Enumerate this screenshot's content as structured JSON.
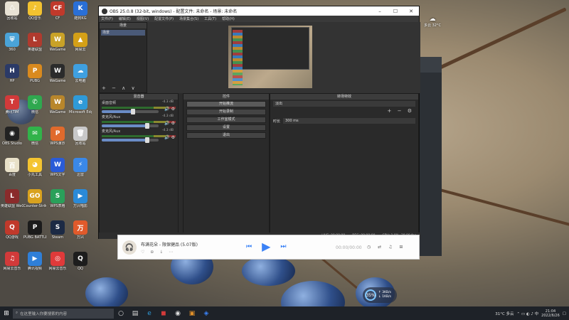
{
  "desktop": {
    "icons": [
      {
        "label": "回收站",
        "color": "#e8e2d4",
        "glyph": "♺"
      },
      {
        "label": "QQ音乐",
        "color": "#f2c230",
        "glyph": "♪"
      },
      {
        "label": "CF",
        "color": "#c0392b",
        "glyph": "CF"
      },
      {
        "label": "酷狗KG",
        "color": "#2a6fd6",
        "glyph": "K"
      },
      {
        "label": "360",
        "color": "#4aa3d8",
        "glyph": "⛨"
      },
      {
        "label": "英雄联盟",
        "color": "#b03a2e",
        "glyph": "L"
      },
      {
        "label": "WeGame",
        "color": "#c9a227",
        "glyph": "W"
      },
      {
        "label": "网易云",
        "color": "#d4a017",
        "glyph": "▲"
      },
      {
        "label": "HP",
        "color": "#2b3a67",
        "glyph": "H"
      },
      {
        "label": "PUBG",
        "color": "#d98a1e",
        "glyph": "P"
      },
      {
        "label": "WeGame",
        "color": "#2b2b2b",
        "glyph": "W"
      },
      {
        "label": "云电脑",
        "color": "#3fa0e0",
        "glyph": "☁"
      },
      {
        "label": "腾讯TIM",
        "color": "#d23a3a",
        "glyph": "T"
      },
      {
        "label": "微信",
        "color": "#2fa84f",
        "glyph": "✆"
      },
      {
        "label": "WeGame",
        "color": "#b8862b",
        "glyph": "W"
      },
      {
        "label": "Microsoft Edge",
        "color": "#2f9ad8",
        "glyph": "e"
      },
      {
        "label": "OBS Studio",
        "color": "#222222",
        "glyph": "◉"
      },
      {
        "label": "微信",
        "color": "#31b34a",
        "glyph": "✉"
      },
      {
        "label": "WPS演示",
        "color": "#e06a2c",
        "glyph": "P"
      },
      {
        "label": "回收站",
        "color": "#c8c8c8",
        "glyph": "🗑"
      },
      {
        "label": "百度",
        "color": "#e8e0c8",
        "glyph": "百"
      },
      {
        "label": "小丸工具",
        "color": "#f4c430",
        "glyph": "◕"
      },
      {
        "label": "WPS文字",
        "color": "#2a5bd7",
        "glyph": "W"
      },
      {
        "label": "迅雷",
        "color": "#3a88e8",
        "glyph": "⚡"
      },
      {
        "label": "英雄联盟 WeGame",
        "color": "#8a2b2b",
        "glyph": "L"
      },
      {
        "label": "Counter-Strike Global",
        "color": "#d9a21e",
        "glyph": "GO"
      },
      {
        "label": "WPS表格",
        "color": "#2aa05a",
        "glyph": "S"
      },
      {
        "label": "万兴喵影",
        "color": "#2a8ad8",
        "glyph": "▶"
      },
      {
        "label": "QQ游戏",
        "color": "#c0392b",
        "glyph": "Q"
      },
      {
        "label": "PUBG BATTLEGR",
        "color": "#1b1b1b",
        "glyph": "P"
      },
      {
        "label": "Steam",
        "color": "#1c2a44",
        "glyph": "S"
      },
      {
        "label": "万兴",
        "color": "#e05a2b",
        "glyph": "万"
      },
      {
        "label": "网易云音乐",
        "color": "#d23a3a",
        "glyph": "♫"
      },
      {
        "label": "腾讯视频",
        "color": "#2f7fd8",
        "glyph": "▶"
      },
      {
        "label": "网易云音乐",
        "color": "#e03a3a",
        "glyph": "◎"
      },
      {
        "label": "QQ",
        "color": "#1d1d1d",
        "glyph": "Q"
      }
    ]
  },
  "obs": {
    "title": "OBS 25.0.8 (32-bit, windows) - 配置文件: 未命名 - 场景: 未命名",
    "menu": [
      "文件(F)",
      "编辑(E)",
      "视图(V)",
      "配置文件(P)",
      "场景集合(S)",
      "工具(T)",
      "帮助(H)"
    ],
    "scenes_header": "场景",
    "scene_item": "场景",
    "mixer_header": "混音器",
    "controls_header": "控件",
    "transitions_header": "转场特效",
    "mixer": [
      {
        "name": "桌面音频",
        "db": "-4.3 dB",
        "level": 0.55
      },
      {
        "name": "麦克风/Aux",
        "db": "-4.3 dB",
        "level": 0.8
      },
      {
        "name": "麦克风/Aux",
        "db": "-4.3 dB",
        "level": 0.8
      }
    ],
    "controls": [
      "开始推流",
      "开始录制",
      "工作室模式",
      "设置",
      "退出"
    ],
    "transition": {
      "type": "淡出",
      "duration_label": "时长",
      "duration_value": "300 ms"
    },
    "status": [
      "LIVE: 00:00:00",
      "REC: 00:00:00",
      "CPU: 1.9%, 30.00 fps"
    ]
  },
  "player": {
    "title": "布满花朵 - 限保健品 (5.07版)",
    "time": "00:00/00:00",
    "icons": "♡ ⊕ ↓ ⋯"
  },
  "widgets": {
    "weather": "多云 32°C",
    "speed": {
      "value": "35%",
      "up": "↑ 3KB/s",
      "down": "↓ 1KB/s"
    }
  },
  "taskbar": {
    "search_placeholder": "在这里输入你要搜索的内容",
    "tray": "31°C 多云",
    "time": "21:04",
    "date": "2022/6/26"
  }
}
